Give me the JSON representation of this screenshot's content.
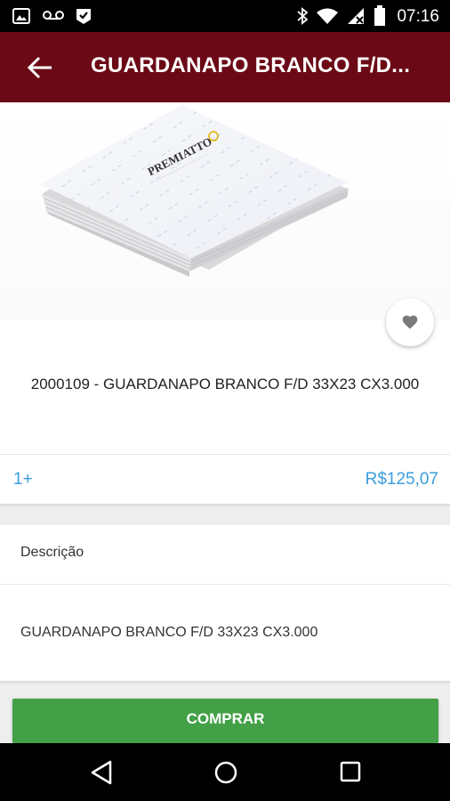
{
  "status_bar": {
    "time": "07:16",
    "left_icons": [
      "image-icon",
      "voicemail-icon",
      "check-badge-icon"
    ],
    "right_icons": [
      "bluetooth-icon",
      "wifi-icon",
      "signal-icon",
      "battery-icon"
    ]
  },
  "app_bar": {
    "title": "GUARDANAPO BRANCO F/D...",
    "background_color": "#6b0a16",
    "back_icon": "arrow-left-icon"
  },
  "product": {
    "image": "napkin-stack-image",
    "brand_logo": "PREMIATTO",
    "name": "2000109 - GUARDANAPO BRANCO F/D 33X23 CX3.000",
    "favorite_icon": "heart-icon"
  },
  "pricing": {
    "quantity": "1+",
    "price": "R$125,07",
    "accent_color": "#3a9edf"
  },
  "description": {
    "header": "Descrição",
    "body": "GUARDANAPO BRANCO F/D 33X23 CX3.000"
  },
  "actions": {
    "buy_label": "COMPRAR",
    "buy_color": "#43a047"
  },
  "nav_bar": {
    "icons": [
      "back-triangle-icon",
      "home-circle-icon",
      "recents-square-icon"
    ]
  }
}
